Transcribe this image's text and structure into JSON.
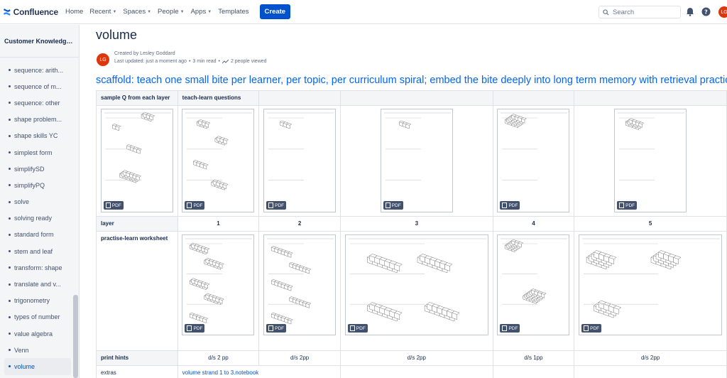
{
  "nav": {
    "logo": "Confluence",
    "items": [
      {
        "label": "Home",
        "chevron": false
      },
      {
        "label": "Recent",
        "chevron": true
      },
      {
        "label": "Spaces",
        "chevron": true
      },
      {
        "label": "People",
        "chevron": true
      },
      {
        "label": "Apps",
        "chevron": true
      },
      {
        "label": "Templates",
        "chevron": false
      }
    ],
    "create": "Create",
    "search_placeholder": "Search",
    "avatar_initials": "LG"
  },
  "sidebar": {
    "space_title": "Customer Knowledge ...",
    "items": [
      "sequence: arith...",
      "sequence of m...",
      "sequence: other",
      "shape problem...",
      "shape skills YC",
      "simplest form",
      "simplifySD",
      "simplifyPQ",
      "solve",
      "solving ready",
      "standard form",
      "stem and leaf",
      "transform: shape",
      "translate and v...",
      "trigonometry",
      "types of number",
      "value algebra",
      "Venn",
      "volume"
    ],
    "active_index": 18
  },
  "page": {
    "title": "volume",
    "author_initials": "LG",
    "created_by": "Created by Lesley Goddard",
    "last_updated": "Last updated: just a moment ago",
    "read_time": "3 min read",
    "viewed": "2 people viewed",
    "heading": "scaffold: teach one small bite per learner, per topic, per curriculum spiral; embed the bite deeply into long term memory with retrieval practice and repeat"
  },
  "table": {
    "row1": {
      "c0": "sample Q from each layer",
      "c1": "teach-learn questions"
    },
    "layer_label": "layer",
    "layers": [
      "1",
      "2",
      "3",
      "4",
      "5"
    ],
    "worksheet_label": "practise-learn worksheet",
    "hints_label": "print hints",
    "hints": [
      "d/s 2 pp",
      "d/s 2pp",
      "d/s 2pp",
      "d/s 1pp",
      "d/s 2pp"
    ],
    "extras_label": "extras",
    "extras_link": "volume strand 1 to 3.notebook",
    "pdf": "PDF"
  }
}
